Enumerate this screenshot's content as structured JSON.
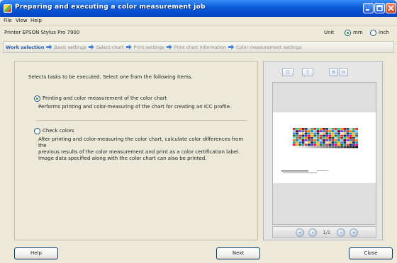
{
  "window": {
    "title": "Preparing and executing a color measurement job"
  },
  "menu": [
    "File",
    "View",
    "Help"
  ],
  "printer": {
    "label": "Printer EPSON Stylus Pro 7900"
  },
  "unit": {
    "label": "Unit",
    "options": [
      "mm",
      "inch"
    ],
    "selected": "mm"
  },
  "steps": [
    "Work selection",
    "Basic settings",
    "Select chart",
    "Print settings",
    "Print chart information",
    "Color measurement settings"
  ],
  "active_step": "Work selection",
  "main": {
    "instructions": "Selects tasks to be executed. Select one from the following items.",
    "options": [
      {
        "title": "Printing and color measurement of the color chart",
        "description": "Performs printing and color-measuring of the chart for creating an ICC profile.",
        "selected": true
      },
      {
        "title": "Check colors",
        "description_lines": [
          "After printing and color-measuring the color chart, calculate color differences from the",
          "previous results of the color measurement and print as a color certification label.",
          "Image data specified along with the color chart can also be printed."
        ],
        "selected": false
      }
    ]
  },
  "preview": {
    "page_indicator": "1/1",
    "toolbar_icons": [
      "fit-page-icon",
      "actual-size-icon",
      "zoom-in-icon",
      "zoom-out-icon"
    ],
    "nav_icons": [
      "first-page-icon",
      "previous-page-icon",
      "next-page-icon",
      "last-page-icon"
    ]
  },
  "buttons": {
    "help": "Help",
    "next": "Next",
    "close": "Close"
  },
  "colors": {
    "titlebar": "#0a5bd9",
    "active_step": "#2a5aa8",
    "step_arrow": "#3d7bd6"
  }
}
